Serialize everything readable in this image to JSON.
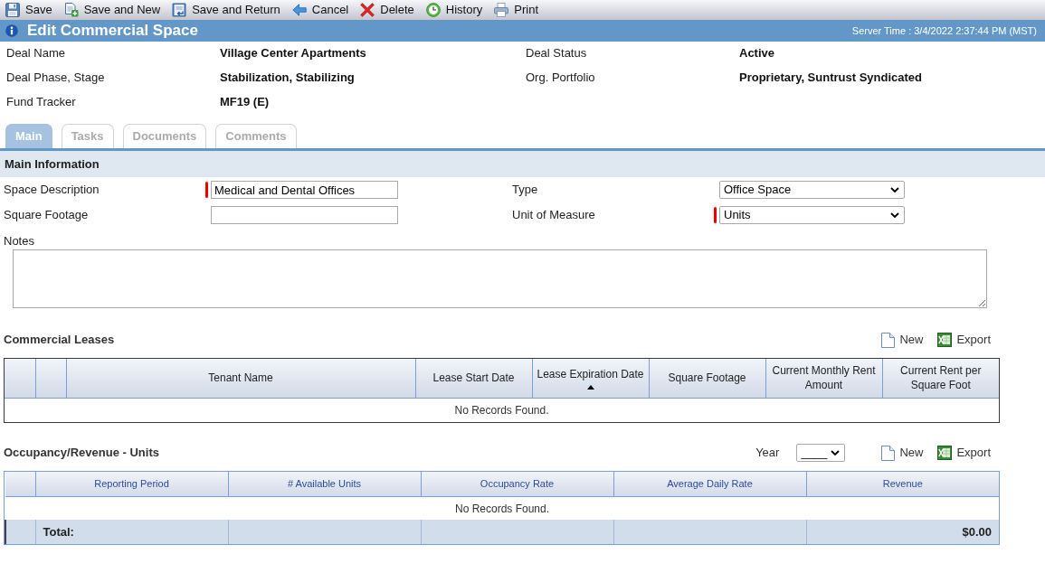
{
  "toolbar": [
    {
      "kind": "save",
      "label": "Save"
    },
    {
      "kind": "save-and-new",
      "label": "Save and New"
    },
    {
      "kind": "save-and-return",
      "label": "Save and Return"
    },
    {
      "kind": "cancel",
      "label": "Cancel"
    },
    {
      "kind": "delete",
      "label": "Delete"
    },
    {
      "kind": "history",
      "label": "History"
    },
    {
      "kind": "print",
      "label": "Print"
    }
  ],
  "header": {
    "title": "Edit Commercial Space",
    "server_time": "Server Time : 3/4/2022 2:37:44 PM (MST)"
  },
  "deal_info": [
    {
      "label": "Deal Name",
      "value": "Village Center Apartments"
    },
    {
      "label": "Deal Status",
      "value": "Active"
    },
    {
      "label": "Deal Phase, Stage",
      "value": "Stabilization, Stabilizing"
    },
    {
      "label": "Org. Portfolio",
      "value": "Proprietary, Suntrust Syndicated"
    },
    {
      "label": "Fund Tracker",
      "value": "MF19 (E)"
    }
  ],
  "tabs": [
    {
      "label": "Main",
      "selected": true
    },
    {
      "label": "Tasks",
      "selected": false
    },
    {
      "label": "Documents",
      "selected": false
    },
    {
      "label": "Comments",
      "selected": false
    }
  ],
  "main_information": {
    "title": "Main Information",
    "fields": [
      {
        "kind": "text",
        "label": "Space Description",
        "value": "Medical and Dental Offices",
        "required": true
      },
      {
        "kind": "select",
        "label": "Type",
        "value": "Office Space",
        "required": false
      },
      {
        "kind": "text",
        "label": "Square Footage",
        "required": false
      },
      {
        "kind": "select",
        "label": "Unit of Measure",
        "value": "Units",
        "required": true
      }
    ],
    "notes": {
      "label": "Notes"
    }
  },
  "commercial_leases": {
    "title": "Commercial Leases",
    "actions": [
      {
        "kind": "new",
        "label": "New"
      },
      {
        "kind": "export",
        "label": "Export"
      }
    ],
    "columns": [
      {
        "label": "Tenant Name",
        "sorted": false
      },
      {
        "label": "Lease Start Date",
        "sorted": false
      },
      {
        "label": "Lease Expiration Date",
        "sorted": true
      },
      {
        "label": "Square Footage",
        "sorted": false
      },
      {
        "label": "Current Monthly Rent Amount",
        "sorted": false
      },
      {
        "label": "Current Rent per Square Foot",
        "sorted": false
      }
    ],
    "empty_message": "No Records Found."
  },
  "occupancy_revenue": {
    "title": "Occupancy/Revenue - Units",
    "year": {
      "label": "Year",
      "value": "____"
    },
    "actions": [
      {
        "kind": "new",
        "label": "New"
      },
      {
        "kind": "export",
        "label": "Export"
      }
    ],
    "columns": [
      {
        "label": "Reporting Period"
      },
      {
        "label": "# Available Units"
      },
      {
        "label": "Occupancy Rate"
      },
      {
        "label": "Average Daily Rate"
      },
      {
        "label": "Revenue"
      }
    ],
    "empty_message": "No Records Found.",
    "total": {
      "label": "Total:",
      "revenue": "$0.00"
    }
  }
}
